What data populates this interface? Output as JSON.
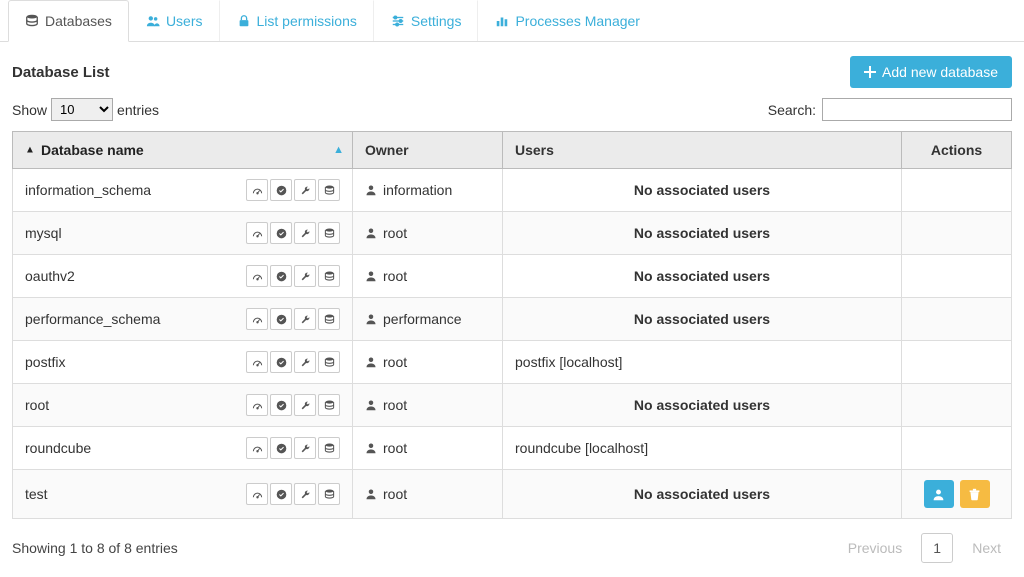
{
  "tabs": [
    {
      "label": "Databases",
      "icon": "database"
    },
    {
      "label": "Users",
      "icon": "users"
    },
    {
      "label": "List permissions",
      "icon": "lock"
    },
    {
      "label": "Settings",
      "icon": "sliders"
    },
    {
      "label": "Processes Manager",
      "icon": "bar-chart"
    }
  ],
  "active_tab_index": 0,
  "page_title": "Database List",
  "add_button_label": "Add new database",
  "show_prefix": "Show",
  "show_suffix": "entries",
  "page_size_options": [
    "10",
    "25",
    "50",
    "100"
  ],
  "page_size_selected": "10",
  "search_label": "Search:",
  "search_value": "",
  "columns": {
    "name": "Database name",
    "owner": "Owner",
    "users": "Users",
    "actions": "Actions"
  },
  "no_users_text": "No associated users",
  "rows": [
    {
      "name": "information_schema",
      "owner": "information",
      "users": [],
      "show_actions": false
    },
    {
      "name": "mysql",
      "owner": "root",
      "users": [],
      "show_actions": false
    },
    {
      "name": "oauthv2",
      "owner": "root",
      "users": [],
      "show_actions": false
    },
    {
      "name": "performance_schema",
      "owner": "performance",
      "users": [],
      "show_actions": false
    },
    {
      "name": "postfix",
      "owner": "root",
      "users": [
        "postfix [localhost]"
      ],
      "show_actions": false
    },
    {
      "name": "root",
      "owner": "root",
      "users": [],
      "show_actions": false
    },
    {
      "name": "roundcube",
      "owner": "root",
      "users": [
        "roundcube [localhost]"
      ],
      "show_actions": false
    },
    {
      "name": "test",
      "owner": "root",
      "users": [],
      "show_actions": true
    }
  ],
  "footer_info": "Showing 1 to 8 of 8 entries",
  "pagination": {
    "previous": "Previous",
    "next": "Next",
    "current": "1"
  },
  "colors": {
    "accent": "#3bafda",
    "warn": "#f6bb42"
  }
}
